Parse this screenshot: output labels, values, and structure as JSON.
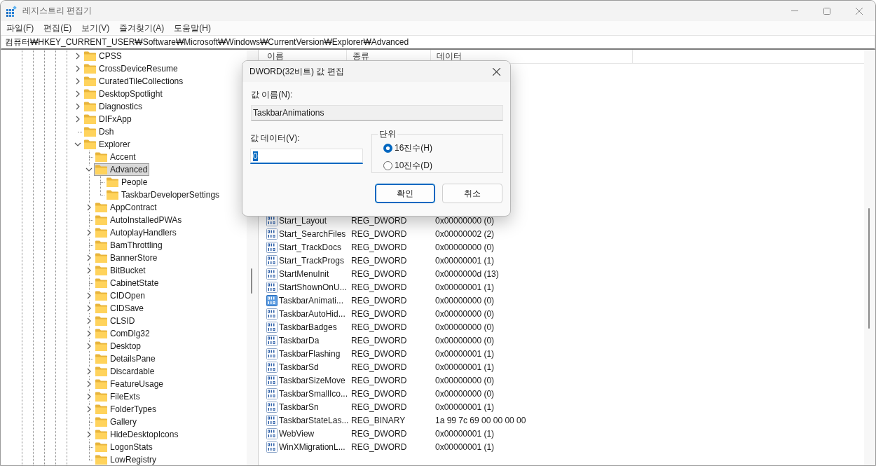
{
  "window": {
    "title": "레지스트리 편집기"
  },
  "menu": [
    "파일(F)",
    "편집(E)",
    "보기(V)",
    "즐겨찾기(A)",
    "도움말(H)"
  ],
  "address": "컴퓨터₩HKEY_CURRENT_USER₩Software₩Microsoft₩Windows₩CurrentVersion₩Explorer₩Advanced",
  "tree": [
    {
      "label": "CPSS",
      "kind": "branch",
      "expanded": false,
      "selected": false
    },
    {
      "label": "CrossDeviceResume",
      "kind": "branch",
      "expanded": false,
      "selected": false
    },
    {
      "label": "CuratedTileCollections",
      "kind": "branch",
      "expanded": false,
      "selected": false
    },
    {
      "label": "DesktopSpotlight",
      "kind": "branch",
      "expanded": false,
      "selected": false
    },
    {
      "label": "Diagnostics",
      "kind": "branch",
      "expanded": false,
      "selected": false
    },
    {
      "label": "DIFxApp",
      "kind": "branch",
      "expanded": false,
      "selected": false
    },
    {
      "label": "Dsh",
      "kind": "leaf",
      "selected": false
    },
    {
      "label": "Explorer",
      "kind": "branch",
      "expanded": true,
      "selected": false,
      "children": [
        {
          "label": "Accent",
          "kind": "leaf",
          "selected": false
        },
        {
          "label": "Advanced",
          "kind": "branch",
          "expanded": true,
          "selected": true,
          "children": [
            {
              "label": "People",
              "kind": "leaf",
              "selected": false
            },
            {
              "label": "TaskbarDeveloperSettings",
              "kind": "leaf",
              "selected": false
            }
          ]
        },
        {
          "label": "AppContract",
          "kind": "branch",
          "expanded": false,
          "selected": false
        },
        {
          "label": "AutoInstalledPWAs",
          "kind": "leaf",
          "selected": false
        },
        {
          "label": "AutoplayHandlers",
          "kind": "branch",
          "expanded": false,
          "selected": false
        },
        {
          "label": "BamThrottling",
          "kind": "leaf",
          "selected": false
        },
        {
          "label": "BannerStore",
          "kind": "branch",
          "expanded": false,
          "selected": false
        },
        {
          "label": "BitBucket",
          "kind": "branch",
          "expanded": false,
          "selected": false
        },
        {
          "label": "CabinetState",
          "kind": "leaf",
          "selected": false
        },
        {
          "label": "CIDOpen",
          "kind": "branch",
          "expanded": false,
          "selected": false
        },
        {
          "label": "CIDSave",
          "kind": "branch",
          "expanded": false,
          "selected": false
        },
        {
          "label": "CLSID",
          "kind": "branch",
          "expanded": false,
          "selected": false
        },
        {
          "label": "ComDlg32",
          "kind": "branch",
          "expanded": false,
          "selected": false
        },
        {
          "label": "Desktop",
          "kind": "branch",
          "expanded": false,
          "selected": false
        },
        {
          "label": "DetailsPane",
          "kind": "leaf",
          "selected": false
        },
        {
          "label": "Discardable",
          "kind": "branch",
          "expanded": false,
          "selected": false
        },
        {
          "label": "FeatureUsage",
          "kind": "branch",
          "expanded": false,
          "selected": false
        },
        {
          "label": "FileExts",
          "kind": "branch",
          "expanded": false,
          "selected": false
        },
        {
          "label": "FolderTypes",
          "kind": "branch",
          "expanded": false,
          "selected": false
        },
        {
          "label": "Gallery",
          "kind": "leaf",
          "selected": false
        },
        {
          "label": "HideDesktopIcons",
          "kind": "branch",
          "expanded": false,
          "selected": false
        },
        {
          "label": "LogonStats",
          "kind": "leaf",
          "selected": false
        },
        {
          "label": "LowRegistry",
          "kind": "leaf",
          "selected": false
        }
      ]
    }
  ],
  "list": {
    "columns": [
      "이름",
      "종류",
      "데이터"
    ],
    "rows": [
      {
        "name": "Start_Layout",
        "type": "REG_DWORD",
        "data": "0x00000000 (0)",
        "selected": false
      },
      {
        "name": "Start_SearchFiles",
        "type": "REG_DWORD",
        "data": "0x00000002 (2)",
        "selected": false
      },
      {
        "name": "Start_TrackDocs",
        "type": "REG_DWORD",
        "data": "0x00000000 (0)",
        "selected": false
      },
      {
        "name": "Start_TrackProgs",
        "type": "REG_DWORD",
        "data": "0x00000001 (1)",
        "selected": false
      },
      {
        "name": "StartMenuInit",
        "type": "REG_DWORD",
        "data": "0x0000000d (13)",
        "selected": false
      },
      {
        "name": "StartShownOnU...",
        "type": "REG_DWORD",
        "data": "0x00000001 (1)",
        "selected": false
      },
      {
        "name": "TaskbarAnimati...",
        "type": "REG_DWORD",
        "data": "0x00000000 (0)",
        "selected": true
      },
      {
        "name": "TaskbarAutoHid...",
        "type": "REG_DWORD",
        "data": "0x00000000 (0)",
        "selected": false
      },
      {
        "name": "TaskbarBadges",
        "type": "REG_DWORD",
        "data": "0x00000000 (0)",
        "selected": false
      },
      {
        "name": "TaskbarDa",
        "type": "REG_DWORD",
        "data": "0x00000000 (0)",
        "selected": false
      },
      {
        "name": "TaskbarFlashing",
        "type": "REG_DWORD",
        "data": "0x00000001 (1)",
        "selected": false
      },
      {
        "name": "TaskbarSd",
        "type": "REG_DWORD",
        "data": "0x00000001 (1)",
        "selected": false
      },
      {
        "name": "TaskbarSizeMove",
        "type": "REG_DWORD",
        "data": "0x00000000 (0)",
        "selected": false
      },
      {
        "name": "TaskbarSmallIco...",
        "type": "REG_DWORD",
        "data": "0x00000000 (0)",
        "selected": false
      },
      {
        "name": "TaskbarSn",
        "type": "REG_DWORD",
        "data": "0x00000001 (1)",
        "selected": false
      },
      {
        "name": "TaskbarStateLas...",
        "type": "REG_BINARY",
        "data": "1a 99 7c 69 00 00 00 00",
        "selected": false
      },
      {
        "name": "WebView",
        "type": "REG_DWORD",
        "data": "0x00000001 (1)",
        "selected": false
      },
      {
        "name": "WinXMigrationL...",
        "type": "REG_DWORD",
        "data": "0x00000001 (1)",
        "selected": false
      }
    ]
  },
  "dialog": {
    "title": "DWORD(32비트) 값 편집",
    "name_label": "값 이름(N):",
    "name_value": "TaskbarAnimations",
    "data_label": "값 데이터(V):",
    "data_value": "0",
    "data_value_highlighted": true,
    "base": {
      "label": "단위",
      "options": [
        {
          "label": "16진수(H)",
          "selected": true
        },
        {
          "label": "10진수(D)",
          "selected": false
        }
      ]
    },
    "buttons": [
      {
        "label": "확인",
        "default": true
      },
      {
        "label": "취소",
        "default": false
      }
    ]
  }
}
